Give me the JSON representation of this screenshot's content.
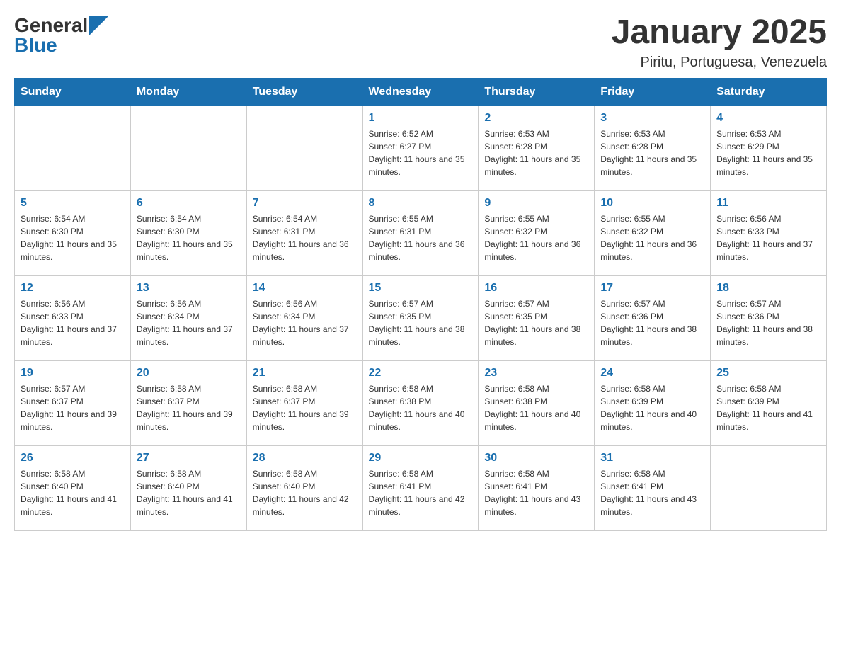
{
  "header": {
    "logo_general": "General",
    "logo_blue": "Blue",
    "title": "January 2025",
    "subtitle": "Piritu, Portuguesa, Venezuela"
  },
  "days_of_week": [
    "Sunday",
    "Monday",
    "Tuesday",
    "Wednesday",
    "Thursday",
    "Friday",
    "Saturday"
  ],
  "weeks": [
    [
      {
        "day": "",
        "info": ""
      },
      {
        "day": "",
        "info": ""
      },
      {
        "day": "",
        "info": ""
      },
      {
        "day": "1",
        "info": "Sunrise: 6:52 AM\nSunset: 6:27 PM\nDaylight: 11 hours and 35 minutes."
      },
      {
        "day": "2",
        "info": "Sunrise: 6:53 AM\nSunset: 6:28 PM\nDaylight: 11 hours and 35 minutes."
      },
      {
        "day": "3",
        "info": "Sunrise: 6:53 AM\nSunset: 6:28 PM\nDaylight: 11 hours and 35 minutes."
      },
      {
        "day": "4",
        "info": "Sunrise: 6:53 AM\nSunset: 6:29 PM\nDaylight: 11 hours and 35 minutes."
      }
    ],
    [
      {
        "day": "5",
        "info": "Sunrise: 6:54 AM\nSunset: 6:30 PM\nDaylight: 11 hours and 35 minutes."
      },
      {
        "day": "6",
        "info": "Sunrise: 6:54 AM\nSunset: 6:30 PM\nDaylight: 11 hours and 35 minutes."
      },
      {
        "day": "7",
        "info": "Sunrise: 6:54 AM\nSunset: 6:31 PM\nDaylight: 11 hours and 36 minutes."
      },
      {
        "day": "8",
        "info": "Sunrise: 6:55 AM\nSunset: 6:31 PM\nDaylight: 11 hours and 36 minutes."
      },
      {
        "day": "9",
        "info": "Sunrise: 6:55 AM\nSunset: 6:32 PM\nDaylight: 11 hours and 36 minutes."
      },
      {
        "day": "10",
        "info": "Sunrise: 6:55 AM\nSunset: 6:32 PM\nDaylight: 11 hours and 36 minutes."
      },
      {
        "day": "11",
        "info": "Sunrise: 6:56 AM\nSunset: 6:33 PM\nDaylight: 11 hours and 37 minutes."
      }
    ],
    [
      {
        "day": "12",
        "info": "Sunrise: 6:56 AM\nSunset: 6:33 PM\nDaylight: 11 hours and 37 minutes."
      },
      {
        "day": "13",
        "info": "Sunrise: 6:56 AM\nSunset: 6:34 PM\nDaylight: 11 hours and 37 minutes."
      },
      {
        "day": "14",
        "info": "Sunrise: 6:56 AM\nSunset: 6:34 PM\nDaylight: 11 hours and 37 minutes."
      },
      {
        "day": "15",
        "info": "Sunrise: 6:57 AM\nSunset: 6:35 PM\nDaylight: 11 hours and 38 minutes."
      },
      {
        "day": "16",
        "info": "Sunrise: 6:57 AM\nSunset: 6:35 PM\nDaylight: 11 hours and 38 minutes."
      },
      {
        "day": "17",
        "info": "Sunrise: 6:57 AM\nSunset: 6:36 PM\nDaylight: 11 hours and 38 minutes."
      },
      {
        "day": "18",
        "info": "Sunrise: 6:57 AM\nSunset: 6:36 PM\nDaylight: 11 hours and 38 minutes."
      }
    ],
    [
      {
        "day": "19",
        "info": "Sunrise: 6:57 AM\nSunset: 6:37 PM\nDaylight: 11 hours and 39 minutes."
      },
      {
        "day": "20",
        "info": "Sunrise: 6:58 AM\nSunset: 6:37 PM\nDaylight: 11 hours and 39 minutes."
      },
      {
        "day": "21",
        "info": "Sunrise: 6:58 AM\nSunset: 6:37 PM\nDaylight: 11 hours and 39 minutes."
      },
      {
        "day": "22",
        "info": "Sunrise: 6:58 AM\nSunset: 6:38 PM\nDaylight: 11 hours and 40 minutes."
      },
      {
        "day": "23",
        "info": "Sunrise: 6:58 AM\nSunset: 6:38 PM\nDaylight: 11 hours and 40 minutes."
      },
      {
        "day": "24",
        "info": "Sunrise: 6:58 AM\nSunset: 6:39 PM\nDaylight: 11 hours and 40 minutes."
      },
      {
        "day": "25",
        "info": "Sunrise: 6:58 AM\nSunset: 6:39 PM\nDaylight: 11 hours and 41 minutes."
      }
    ],
    [
      {
        "day": "26",
        "info": "Sunrise: 6:58 AM\nSunset: 6:40 PM\nDaylight: 11 hours and 41 minutes."
      },
      {
        "day": "27",
        "info": "Sunrise: 6:58 AM\nSunset: 6:40 PM\nDaylight: 11 hours and 41 minutes."
      },
      {
        "day": "28",
        "info": "Sunrise: 6:58 AM\nSunset: 6:40 PM\nDaylight: 11 hours and 42 minutes."
      },
      {
        "day": "29",
        "info": "Sunrise: 6:58 AM\nSunset: 6:41 PM\nDaylight: 11 hours and 42 minutes."
      },
      {
        "day": "30",
        "info": "Sunrise: 6:58 AM\nSunset: 6:41 PM\nDaylight: 11 hours and 43 minutes."
      },
      {
        "day": "31",
        "info": "Sunrise: 6:58 AM\nSunset: 6:41 PM\nDaylight: 11 hours and 43 minutes."
      },
      {
        "day": "",
        "info": ""
      }
    ]
  ]
}
